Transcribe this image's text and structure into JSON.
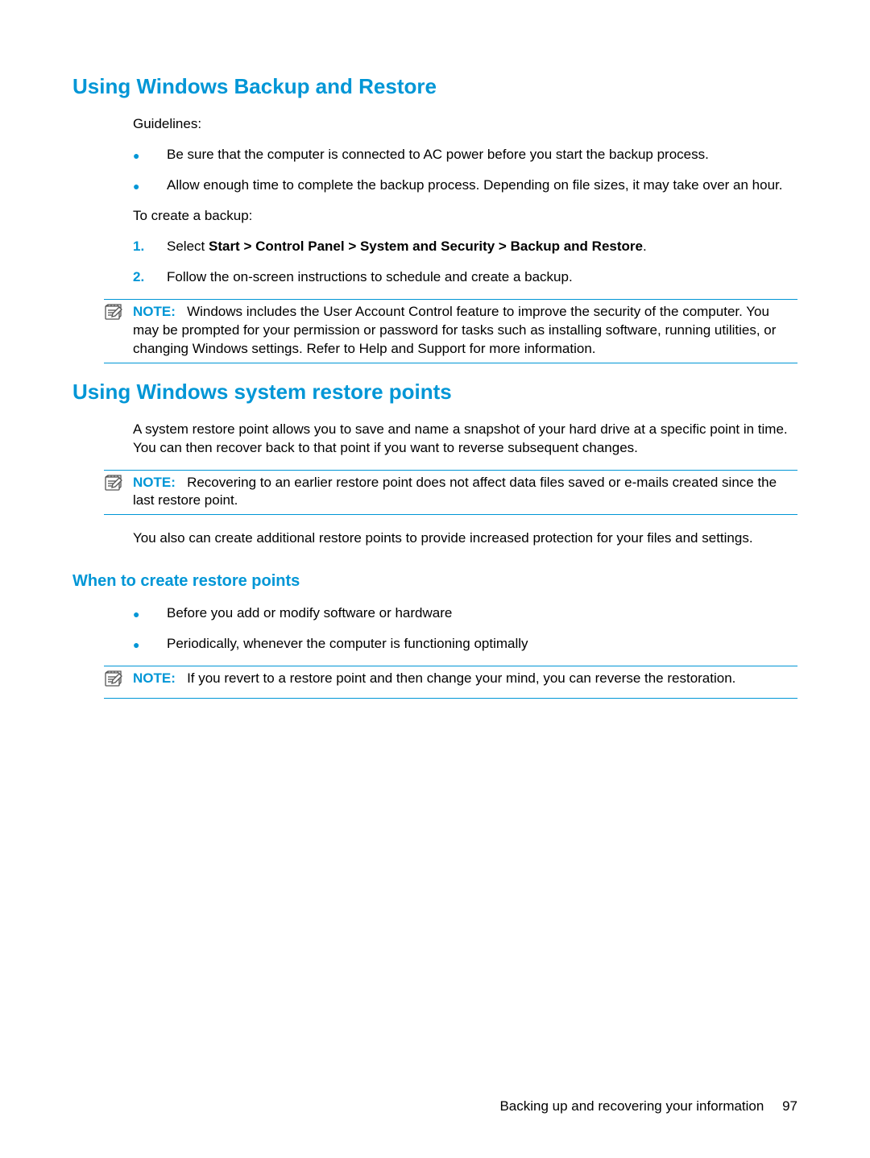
{
  "sections": {
    "backup_restore": {
      "heading": "Using Windows Backup and Restore",
      "guidelines_label": "Guidelines:",
      "bullets": [
        "Be sure that the computer is connected to AC power before you start the backup process.",
        "Allow enough time to complete the backup process. Depending on file sizes, it may take over an hour."
      ],
      "create_backup_label": "To create a backup:",
      "steps": [
        {
          "num": "1.",
          "prefix": "Select ",
          "bold_path": "Start > Control Panel > System and Security > Backup and Restore",
          "suffix": "."
        },
        {
          "num": "2.",
          "text": "Follow the on-screen instructions to schedule and create a backup."
        }
      ],
      "note": {
        "label": "NOTE:",
        "text": "Windows includes the User Account Control feature to improve the security of the computer. You may be prompted for your permission or password for tasks such as installing software, running utilities, or changing Windows settings. Refer to Help and Support for more information."
      }
    },
    "restore_points": {
      "heading": "Using Windows system restore points",
      "intro": "A system restore point allows you to save and name a snapshot of your hard drive at a specific point in time. You can then recover back to that point if you want to reverse subsequent changes.",
      "note": {
        "label": "NOTE:",
        "text": "Recovering to an earlier restore point does not affect data files saved or e-mails created since the last restore point."
      },
      "additional": "You also can create additional restore points to provide increased protection for your files and settings."
    },
    "when_create": {
      "heading": "When to create restore points",
      "bullets": [
        "Before you add or modify software or hardware",
        "Periodically, whenever the computer is functioning optimally"
      ],
      "note": {
        "label": "NOTE:",
        "text": "If you revert to a restore point and then change your mind, you can reverse the restoration."
      }
    }
  },
  "footer": {
    "text": "Backing up and recovering your information",
    "page": "97"
  }
}
